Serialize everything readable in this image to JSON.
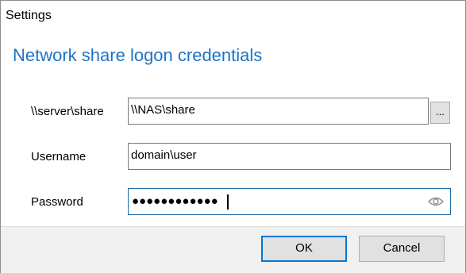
{
  "window": {
    "title": "Settings"
  },
  "heading": "Network share logon credentials",
  "form": {
    "share_label": "\\\\server\\share",
    "share_value": "\\\\NAS\\share",
    "browse_label": "...",
    "username_label": "Username",
    "username_value": "domain\\user",
    "password_label": "Password",
    "password_masked": "●●●●●●●●●●●●"
  },
  "buttons": {
    "ok": "OK",
    "cancel": "Cancel"
  },
  "colors": {
    "accent": "#0078d7",
    "heading": "#1b74c8",
    "footer_bg": "#f0f0f0"
  },
  "icons": {
    "password_reveal": "eye-icon"
  }
}
